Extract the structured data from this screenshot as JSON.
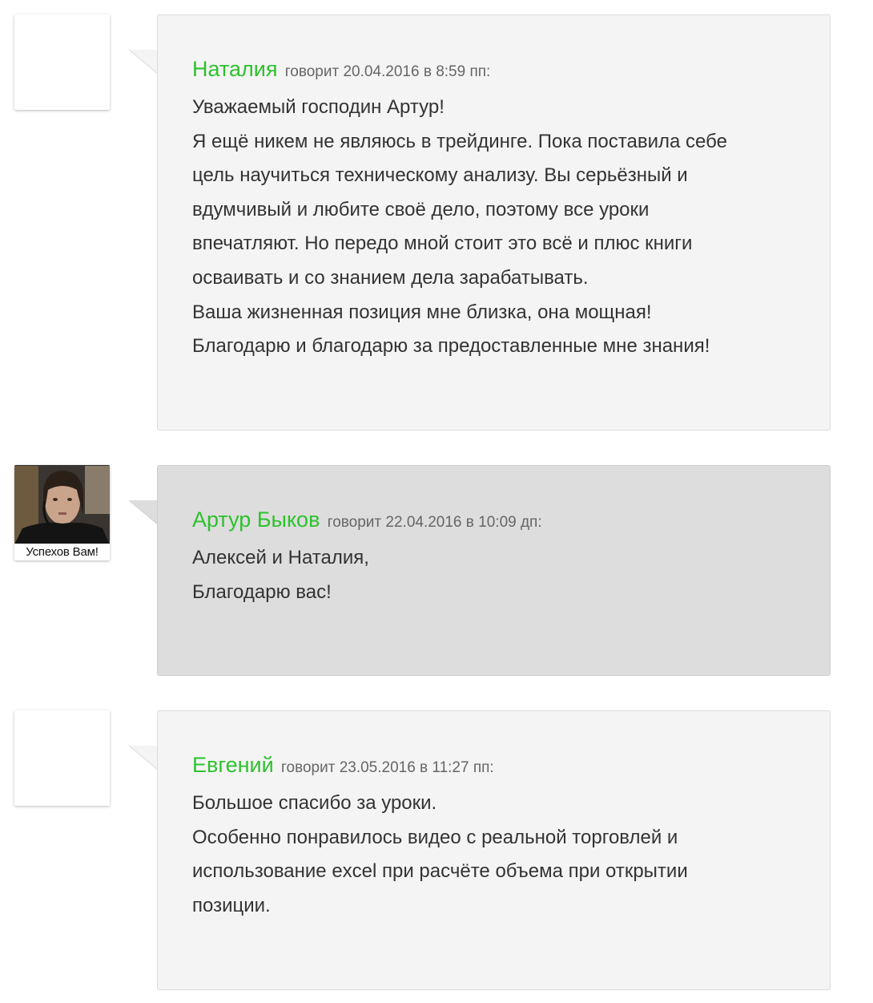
{
  "comments": [
    {
      "author": "Наталия",
      "says": "говорит",
      "date": "20.04.2016 в 8:59 пп:",
      "theme": "light",
      "lines": [
        "Уважаемый господин Артур!",
        "Я ещё никем не являюсь в трейдинге. Пока поставила себе",
        "цель научиться техническому анализу. Вы серьёзный и",
        "вдумчивый и любите своё дело, поэтому все уроки",
        "впечатляют. Но передо мной стоит это всё и плюс книги",
        "осваивать и со знанием дела зарабатывать.",
        "Ваша жизненная позиция мне близка, она мощная!",
        "Благодарю и благодарю за предоставленные мне знания!"
      ]
    },
    {
      "author": "Артур Быков",
      "says": "говорит",
      "date": "22.04.2016 в 10:09 дп:",
      "theme": "dark",
      "avatar_caption": "Успехов Вам!",
      "lines": [
        "Алексей и Наталия,",
        "Благодарю вас!"
      ]
    },
    {
      "author": "Евгений",
      "says": "говорит",
      "date": "23.05.2016 в 11:27 пп:",
      "theme": "light",
      "lines": [
        "Большое спасибо за уроки.",
        "Особенно понравилось видео с реальной торговлей и",
        "использование excel при расчёте объема при открытии",
        "позиции."
      ]
    }
  ],
  "colors": {
    "author_link": "#2ec12e",
    "bubble_light": "#f4f4f4",
    "bubble_dark": "#dddddd",
    "text": "#333333",
    "meta": "#666666"
  }
}
